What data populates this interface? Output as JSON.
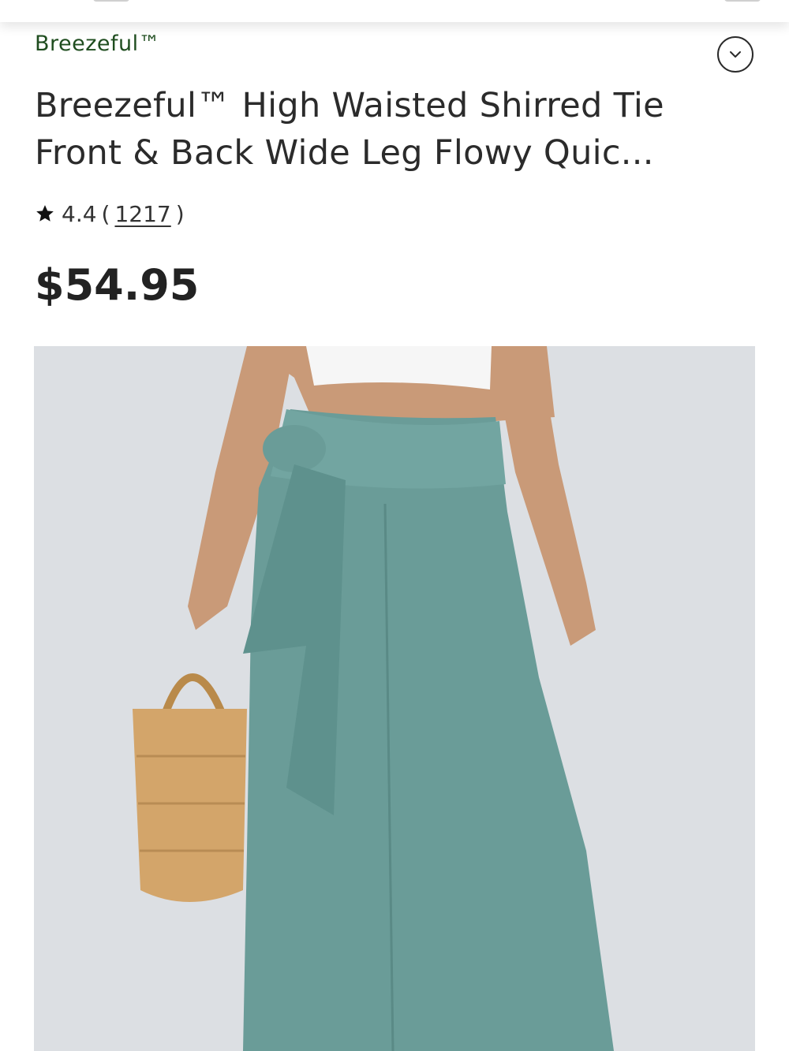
{
  "product": {
    "brand": "Breezeful™",
    "title": "Breezeful™ High Waisted Shirred Tie Front & Back Wide Leg Flowy Quic...",
    "rating": "4.4",
    "review_count": "1217",
    "price": "$54.95",
    "image_icon": "product-photo",
    "colors": {
      "brand": "#1f4d1f",
      "pants": "#6a9c98",
      "background": "#dcdfe3"
    }
  },
  "icons": {
    "expand": "chevron-down-icon",
    "rating": "star-icon"
  }
}
